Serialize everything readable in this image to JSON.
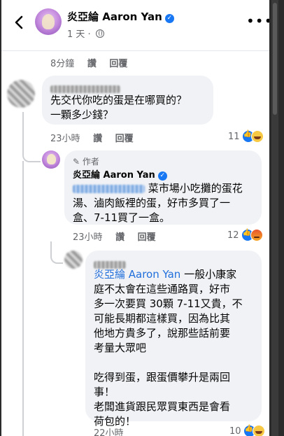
{
  "header": {
    "page_name": "炎亞綸 Aaron Yan",
    "post_age": "1 天",
    "separator": "·"
  },
  "top_actions": {
    "time": "8分鐘",
    "like": "讚",
    "reply": "回覆"
  },
  "comment1": {
    "text": "先交代你吃的蛋是在哪買的？\n一顆多少錢？",
    "actions": {
      "time": "23小時",
      "like": "讚",
      "reply": "回覆"
    },
    "reaction_count": "11",
    "reactions": [
      "like-icon",
      "haha-icon"
    ]
  },
  "reply1": {
    "author_tag": "作者",
    "author": "炎亞綸 Aaron Yan",
    "text_after_mention": "菜市場小吃攤的蛋花",
    "text_rest": "湯、滷肉飯裡的蛋，好市多買了一\n盒、7-11買了一盒。",
    "actions": {
      "time": "23小時",
      "like": "讚",
      "reply": "回覆"
    },
    "reaction_count": "12",
    "reactions": [
      "like-icon",
      "angry-icon"
    ]
  },
  "reply2": {
    "mention": "炎亞綸 Aaron Yan",
    "text_first": " 一般小康家",
    "text_rest": "庭不太會在這些通路買，好市\n多一次要買 30顆 7-11又貴，不\n可能長期都這樣買，因為比其\n他地方貴多了，說那些話前要\n考量大眾吧\n\n吃得到蛋，跟蛋價攀升是兩回\n事！\n老闆進貨跟民眾買東西是會看\n荷包的！",
    "actions": {
      "time": "22小時"
    },
    "reaction_count": "10",
    "reactions": [
      "like-icon",
      "haha-icon"
    ]
  },
  "colors": {
    "link": "#216fdb",
    "verified": "#1877f2",
    "bubble": "#f0f2f5"
  }
}
